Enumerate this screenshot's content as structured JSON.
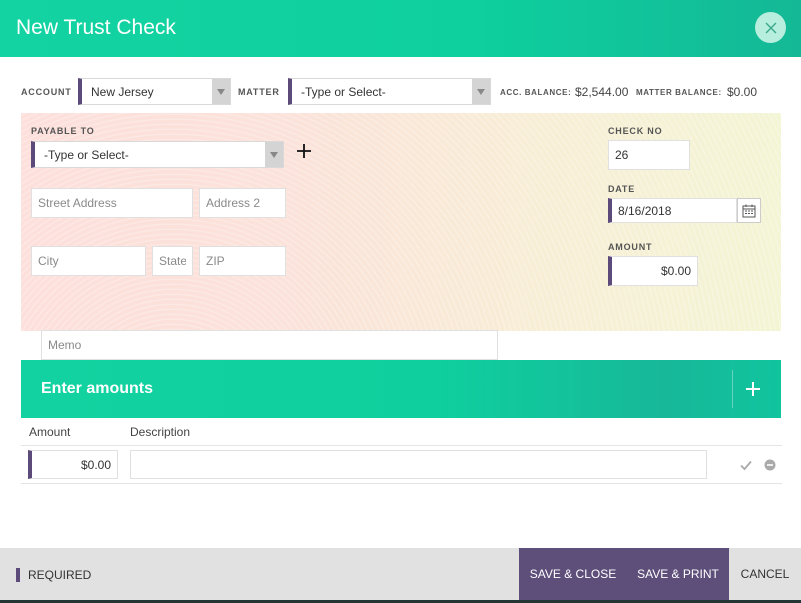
{
  "header": {
    "title": "New Trust Check"
  },
  "top": {
    "account_label": "ACCOUNT",
    "account_value": "New Jersey",
    "matter_label": "MATTER",
    "matter_value": "-Type or Select-",
    "acc_balance_label": "ACC. BALANCE:",
    "acc_balance_value": "$2,544.00",
    "matter_balance_label": "MATTER BALANCE:",
    "matter_balance_value": "$0.00"
  },
  "check": {
    "payable_label": "PAYABLE TO",
    "payable_value": "-Type or Select-",
    "street_placeholder": "Street Address",
    "address2_placeholder": "Address 2",
    "city_placeholder": "City",
    "state_placeholder": "State",
    "zip_placeholder": "ZIP",
    "check_no_label": "CHECK NO",
    "check_no_value": "26",
    "date_label": "DATE",
    "date_value": "8/16/2018",
    "amount_label": "AMOUNT",
    "amount_value": "$0.00",
    "memo_placeholder": "Memo"
  },
  "amounts": {
    "title": "Enter amounts",
    "col_amount": "Amount",
    "col_description": "Description",
    "rows": [
      {
        "amount": "$0.00",
        "description": ""
      }
    ]
  },
  "footer": {
    "required_label": "REQUIRED",
    "save_close_label": "SAVE & CLOSE",
    "save_print_label": "SAVE & PRINT",
    "cancel_label": "CANCEL"
  },
  "icons": {
    "close": "close-icon",
    "dropdown": "chevron-down-icon",
    "add": "plus-icon",
    "calendar": "calendar-icon",
    "confirm": "check-icon",
    "remove": "minus-circle-icon"
  },
  "colors": {
    "accent": "#14d3a2",
    "required_marker": "#5c4a7b",
    "primary_button": "#5d4e7a",
    "footer_bg": "#e1e1e1"
  }
}
